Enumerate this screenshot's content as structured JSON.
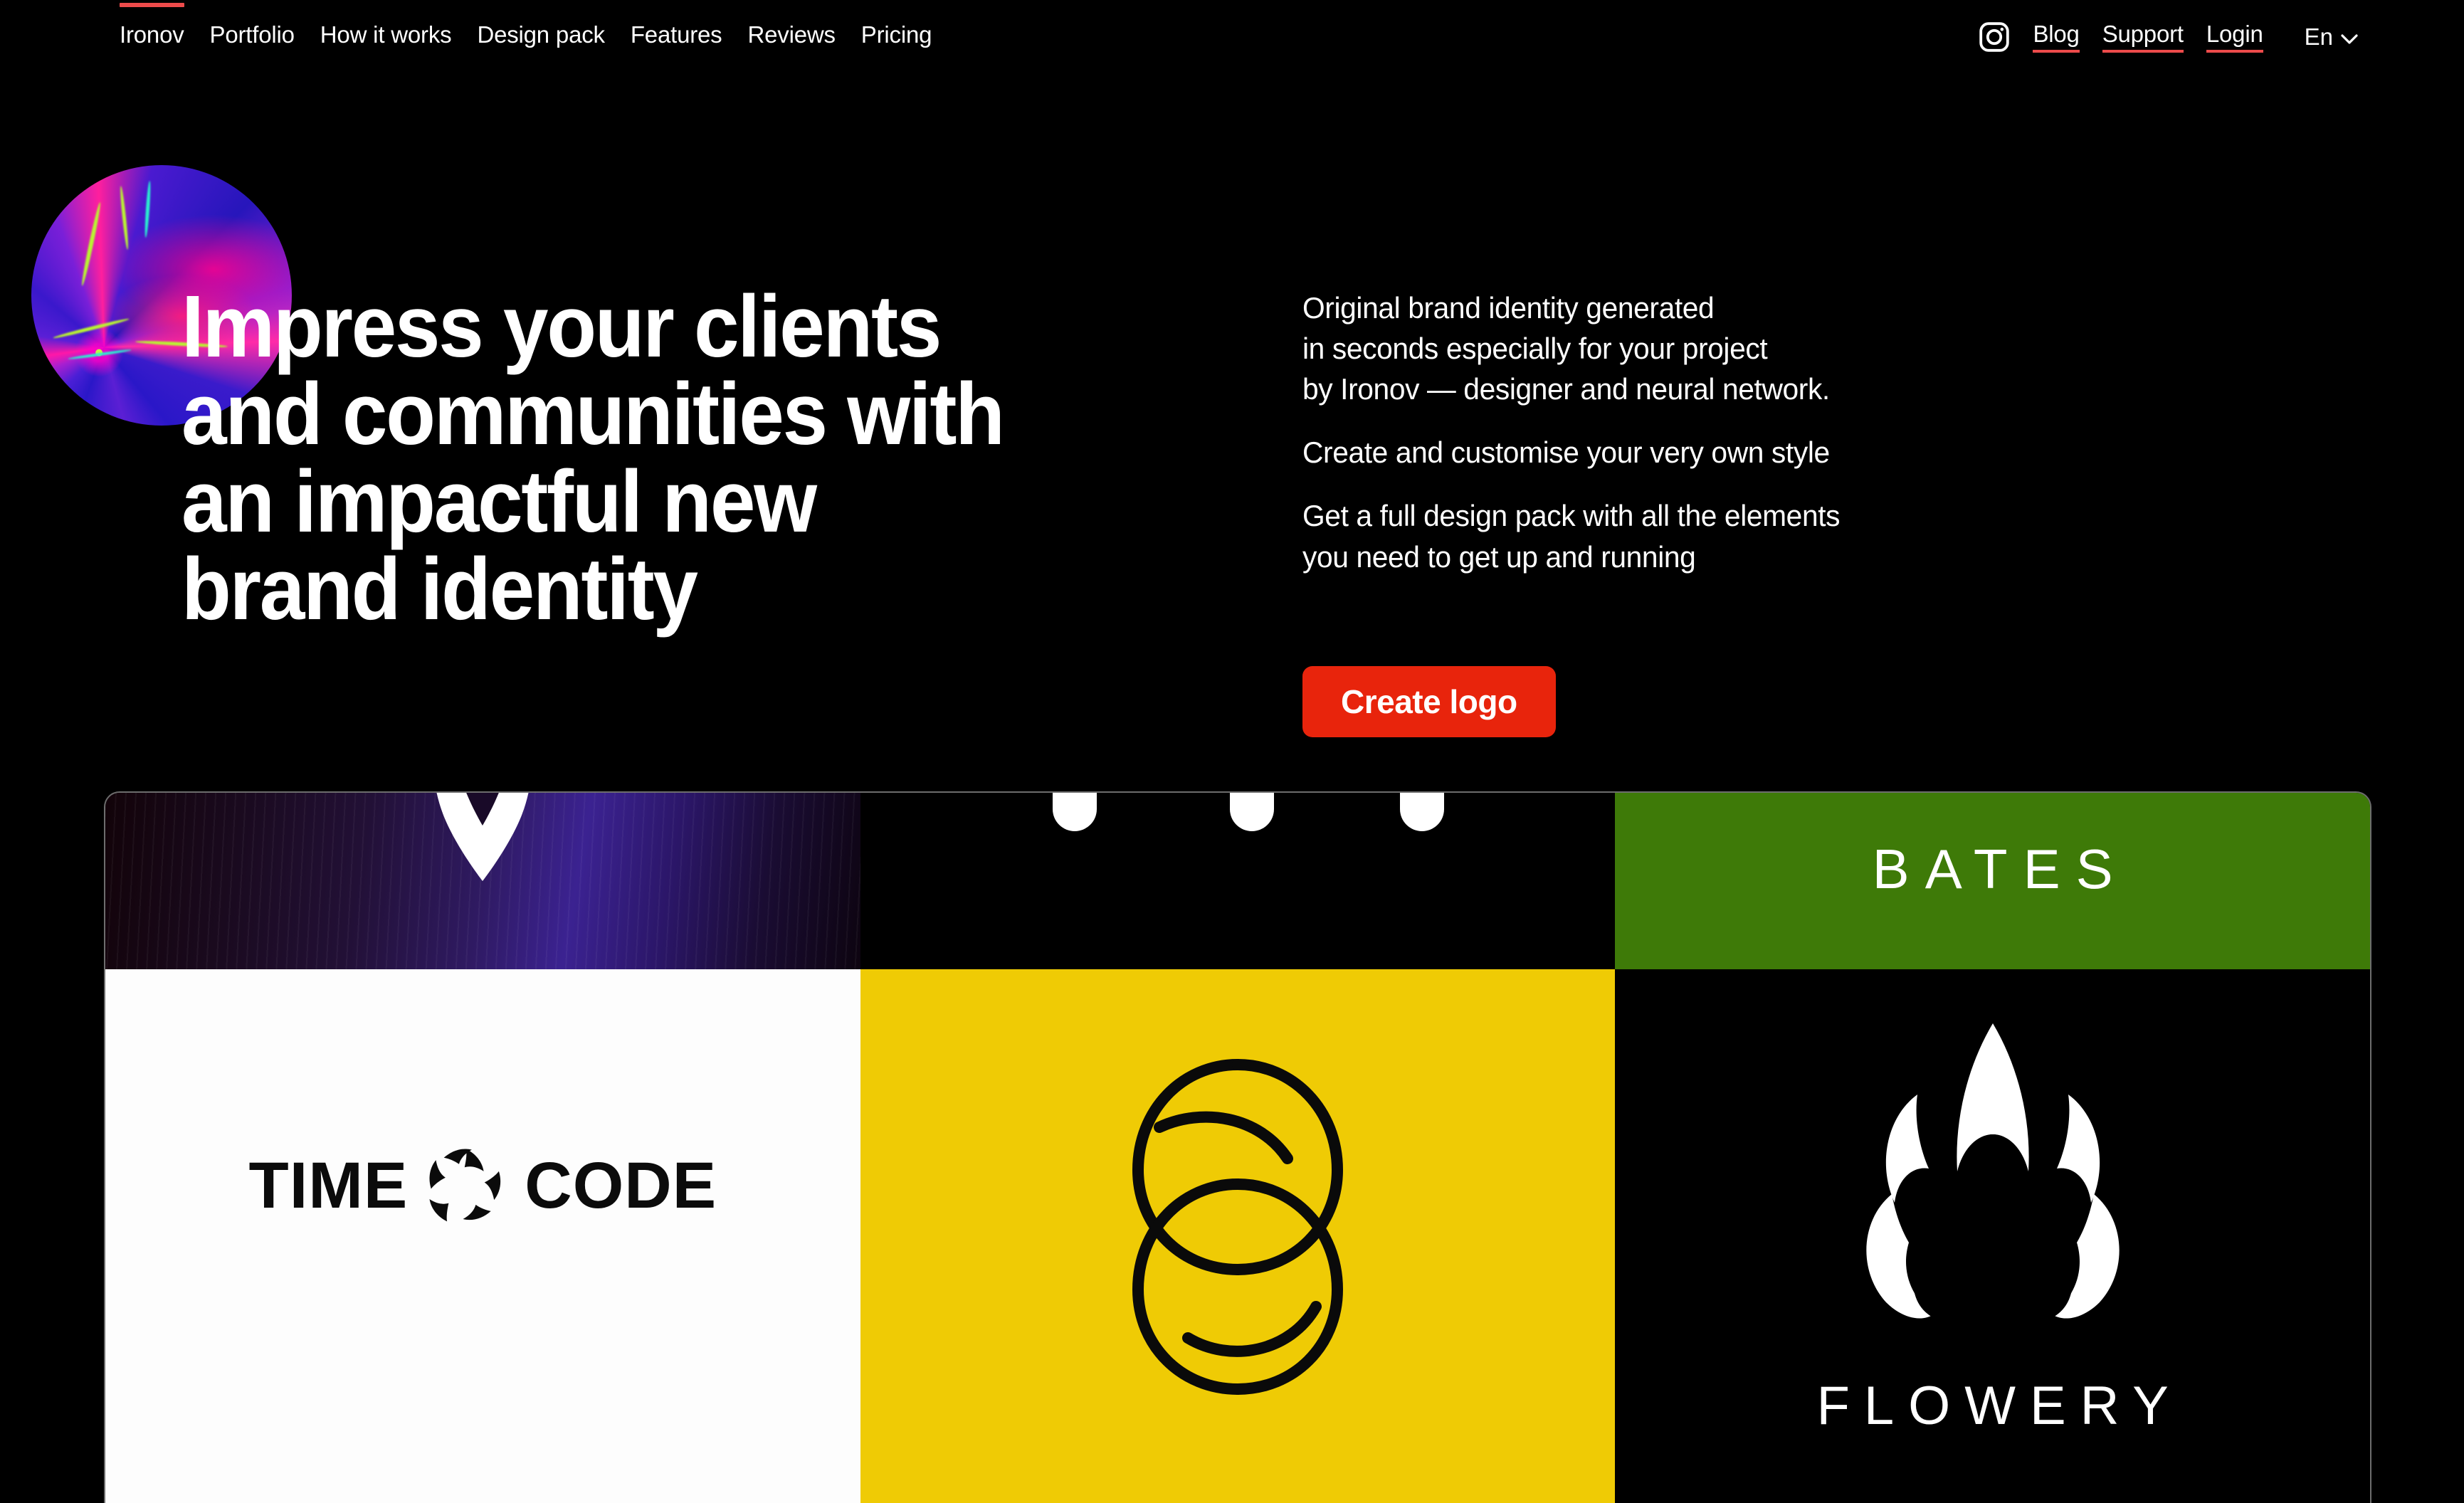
{
  "nav": {
    "brand": "Ironov",
    "items": [
      "Ironov",
      "Portfolio",
      "How it works",
      "Design pack",
      "Features",
      "Reviews",
      "Pricing"
    ],
    "links": [
      "Blog",
      "Support",
      "Login"
    ],
    "language": "En",
    "chevron": "∨",
    "instagram_icon": "instagram-icon",
    "accent_color": "#ED4B4B"
  },
  "hero": {
    "heading_lines": [
      "Impress your clients",
      "and communities with",
      "an impactful new",
      "brand identity"
    ],
    "paragraphs": [
      "Original brand identity generated\nin seconds especially for your project\nby Ironov — designer and neural network.",
      "Create and customise your very own style",
      "Get a full design pack with all the elements\nyou need to get up and running"
    ],
    "cta_label": "Create logo",
    "cta_color": "#E8240C"
  },
  "gallery": {
    "cards": [
      {
        "id": "silk-v",
        "label": "",
        "bg": "#2f1a62"
      },
      {
        "id": "dots",
        "label": "",
        "bg": "#000000"
      },
      {
        "id": "bates",
        "label": "BATES",
        "bg": "#3E7A08"
      },
      {
        "id": "time-code",
        "label_left": "TIME",
        "label_right": "CODE",
        "bg": "#FDFDFD"
      },
      {
        "id": "rings",
        "label": "",
        "bg": "#EFCB05"
      },
      {
        "id": "flowery",
        "label": "FLOWERY",
        "bg": "#000000"
      }
    ]
  }
}
